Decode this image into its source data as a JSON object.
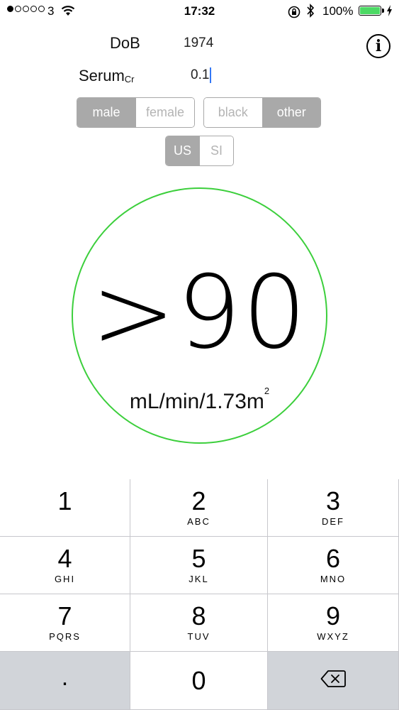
{
  "status_bar": {
    "signal_bars": 1,
    "signal_total": 5,
    "carrier": "3",
    "time": "17:32",
    "battery_percent": "100%",
    "icons": [
      "wifi-icon",
      "rotation-lock-icon",
      "bluetooth-icon",
      "battery-icon",
      "charging-icon"
    ]
  },
  "form": {
    "dob_label": "DoB",
    "dob_value": "1974",
    "serum_label": "Serum",
    "serum_sub": "Cr",
    "serum_value": "0.1"
  },
  "segments": {
    "sex": {
      "options": [
        "male",
        "female"
      ],
      "selected": "male"
    },
    "race": {
      "options": [
        "black",
        "other"
      ],
      "selected": "other"
    },
    "units": {
      "options": [
        "US",
        "SI"
      ],
      "selected": "US"
    }
  },
  "result": {
    "value": ">90",
    "unit": "mL/min/1.73m",
    "unit_sup": "2",
    "ring_color": "#3ccf3c"
  },
  "keypad": {
    "keys": [
      {
        "num": "1",
        "letters": ""
      },
      {
        "num": "2",
        "letters": "ABC"
      },
      {
        "num": "3",
        "letters": "DEF"
      },
      {
        "num": "4",
        "letters": "GHI"
      },
      {
        "num": "5",
        "letters": "JKL"
      },
      {
        "num": "6",
        "letters": "MNO"
      },
      {
        "num": "7",
        "letters": "PQRS"
      },
      {
        "num": "8",
        "letters": "TUV"
      },
      {
        "num": "9",
        "letters": "WXYZ"
      },
      {
        "num": ".",
        "letters": ""
      },
      {
        "num": "0",
        "letters": ""
      },
      {
        "num": "",
        "letters": "",
        "icon": "delete-backspace-icon"
      }
    ]
  }
}
